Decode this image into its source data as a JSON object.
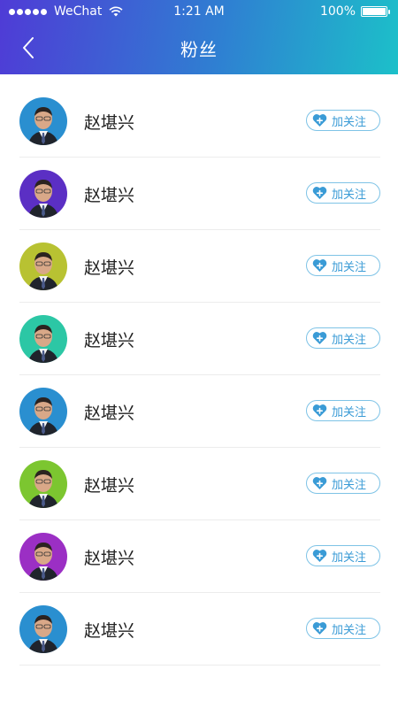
{
  "status_bar": {
    "carrier": "WeChat",
    "time": "1:21 AM",
    "battery": "100%"
  },
  "nav": {
    "title": "粉丝"
  },
  "followers": [
    {
      "name": "赵堪兴",
      "button": "加关注",
      "ring_color": "#2a8fd0"
    },
    {
      "name": "赵堪兴",
      "button": "加关注",
      "ring_color": "#5b2fc4"
    },
    {
      "name": "赵堪兴",
      "button": "加关注",
      "ring_color": "#b8c232"
    },
    {
      "name": "赵堪兴",
      "button": "加关注",
      "ring_color": "#2cc7a5"
    },
    {
      "name": "赵堪兴",
      "button": "加关注",
      "ring_color": "#2a8fd0"
    },
    {
      "name": "赵堪兴",
      "button": "加关注",
      "ring_color": "#7cc630"
    },
    {
      "name": "赵堪兴",
      "button": "加关注",
      "ring_color": "#9b2fc4"
    },
    {
      "name": "赵堪兴",
      "button": "加关注",
      "ring_color": "#2a8fd0"
    }
  ]
}
